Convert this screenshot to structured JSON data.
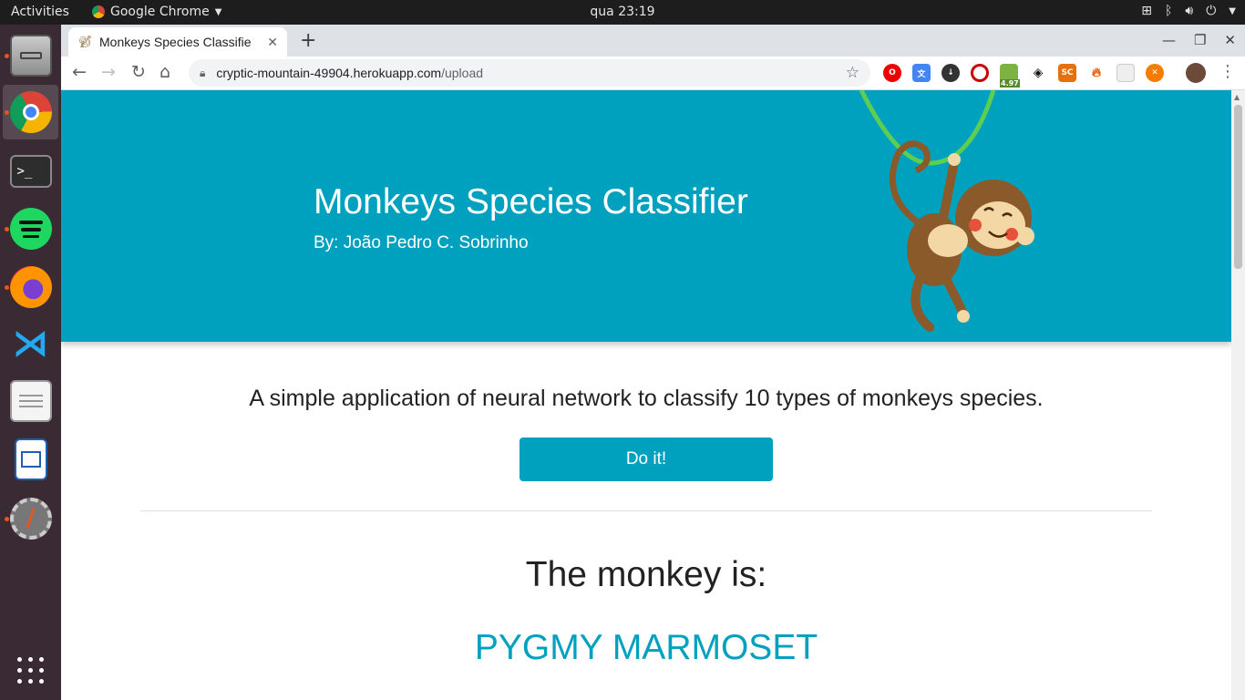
{
  "topbar": {
    "activities": "Activities",
    "app_name": "Google Chrome",
    "clock": "qua 23:19"
  },
  "dock": {
    "items": [
      {
        "name": "files",
        "icon": "file-cabinet-icon"
      },
      {
        "name": "google-chrome",
        "icon": "chrome-icon"
      },
      {
        "name": "terminal",
        "icon": "terminal-icon"
      },
      {
        "name": "spotify",
        "icon": "spotify-icon"
      },
      {
        "name": "firefox",
        "icon": "firefox-icon"
      },
      {
        "name": "vscode",
        "icon": "vscode-icon"
      },
      {
        "name": "text-editor",
        "icon": "notepad-icon"
      },
      {
        "name": "libreoffice-writer",
        "icon": "writer-icon"
      },
      {
        "name": "system-tools",
        "icon": "wrench-icon"
      }
    ]
  },
  "browser": {
    "tab_title": "Monkeys Species Classifie",
    "url_host": "cryptic-mountain-49904.herokuapp.com",
    "url_path": "/upload",
    "ext_badge": "4.97",
    "ext_sc": "SC"
  },
  "page": {
    "title": "Monkeys Species Classifier",
    "author": "By: João Pedro C. Sobrinho",
    "intro": "A simple application of neural network to classify 10 types of monkeys species.",
    "button_label": "Do it!",
    "result_label": "The monkey is:",
    "result_value": "PYGMY MARMOSET"
  },
  "colors": {
    "accent": "#00a0bf",
    "dock_bg": "#3a2a33",
    "topbar_bg": "#1d1d1d"
  }
}
